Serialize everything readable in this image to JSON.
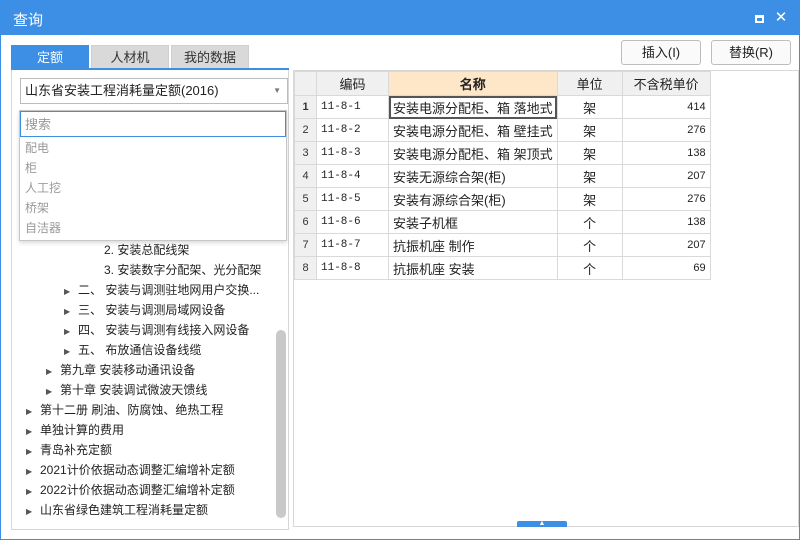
{
  "window": {
    "title": "查询",
    "close_label": "✕"
  },
  "tabs": [
    {
      "label": "定额",
      "active": true
    },
    {
      "label": "人材机",
      "active": false
    },
    {
      "label": "我的数据",
      "active": false
    }
  ],
  "toolbar": {
    "insert_label": "插入(I)",
    "replace_label": "替换(R)"
  },
  "library_combo": {
    "value": "山东省安装工程消耗量定额(2016)"
  },
  "search": {
    "placeholder": "搜索",
    "suggestions": [
      "配电",
      "柜",
      "人工挖",
      "桥架",
      "自洁器"
    ]
  },
  "tree": {
    "items": [
      {
        "label": "2. 安装总配线架",
        "expandable": false
      },
      {
        "label": "3. 安装数字分配架、光分配架",
        "expandable": false
      },
      {
        "label": "二、  安装与调测驻地网用户交换...",
        "expandable": true
      },
      {
        "label": "三、  安装与调测局域网设备",
        "expandable": true
      },
      {
        "label": "四、  安装与调测有线接入网设备",
        "expandable": true
      },
      {
        "label": "五、  布放通信设备线缆",
        "expandable": true
      },
      {
        "label": "第九章 安装移动通讯设备",
        "expandable": true
      },
      {
        "label": "第十章 安装调试微波天馈线",
        "expandable": true
      },
      {
        "label": "第十二册 刷油、防腐蚀、绝热工程",
        "expandable": true
      },
      {
        "label": "单独计算的费用",
        "expandable": true
      },
      {
        "label": "青岛补充定额",
        "expandable": true
      },
      {
        "label": "2021计价依据动态调整汇编增补定额",
        "expandable": true
      },
      {
        "label": "2022计价依据动态调整汇编增补定额",
        "expandable": true
      },
      {
        "label": "山东省绿色建筑工程消耗量定额",
        "expandable": true
      }
    ]
  },
  "grid": {
    "columns": [
      "",
      "编码",
      "名称",
      "单位",
      "不含税单价"
    ],
    "rows": [
      {
        "num": "1",
        "code": "11-8-1",
        "name": "安装电源分配柜、箱 落地式",
        "unit": "架",
        "price": "414"
      },
      {
        "num": "2",
        "code": "11-8-2",
        "name": "安装电源分配柜、箱 壁挂式",
        "unit": "架",
        "price": "276"
      },
      {
        "num": "3",
        "code": "11-8-3",
        "name": "安装电源分配柜、箱 架顶式",
        "unit": "架",
        "price": "138"
      },
      {
        "num": "4",
        "code": "11-8-4",
        "name": "安装无源综合架(柜)",
        "unit": "架",
        "price": "207"
      },
      {
        "num": "5",
        "code": "11-8-5",
        "name": "安装有源综合架(柜)",
        "unit": "架",
        "price": "276"
      },
      {
        "num": "6",
        "code": "11-8-6",
        "name": "安装子机框",
        "unit": "个",
        "price": "138"
      },
      {
        "num": "7",
        "code": "11-8-7",
        "name": "抗振机座 制作",
        "unit": "个",
        "price": "207"
      },
      {
        "num": "8",
        "code": "11-8-8",
        "name": "抗振机座 安装",
        "unit": "个",
        "price": "69"
      }
    ]
  },
  "colors": {
    "accent": "#3c8fe5",
    "active_header": "#fde7c8"
  }
}
